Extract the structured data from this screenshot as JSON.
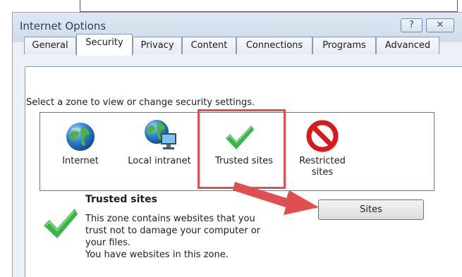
{
  "window": {
    "title": "Internet Options",
    "help_label": "?",
    "close_label": "✕"
  },
  "tabs": [
    {
      "label": "General",
      "active": false
    },
    {
      "label": "Security",
      "active": true
    },
    {
      "label": "Privacy",
      "active": false
    },
    {
      "label": "Content",
      "active": false
    },
    {
      "label": "Connections",
      "active": false
    },
    {
      "label": "Programs",
      "active": false
    },
    {
      "label": "Advanced",
      "active": false
    }
  ],
  "security": {
    "instruction": "Select a zone to view or change security settings.",
    "zones": [
      {
        "line1": "Internet",
        "line2": "",
        "icon": "globe-icon"
      },
      {
        "line1": "Local intranet",
        "line2": "",
        "icon": "intranet-icon"
      },
      {
        "line1": "Trusted sites",
        "line2": "",
        "icon": "checkmark-icon",
        "selected": true
      },
      {
        "line1": "Restricted",
        "line2": "sites",
        "icon": "prohibited-icon"
      }
    ],
    "selected_zone": {
      "title": "Trusted sites",
      "lines": [
        "This zone contains websites that you",
        "trust not to damage your computer or",
        "your files.",
        "You have websites in this zone."
      ]
    },
    "sites_button": "Sites"
  },
  "colors": {
    "annotation_red": "#e04f4f",
    "check_green": "#39b54a",
    "window_bg": "#ecf1f8"
  }
}
